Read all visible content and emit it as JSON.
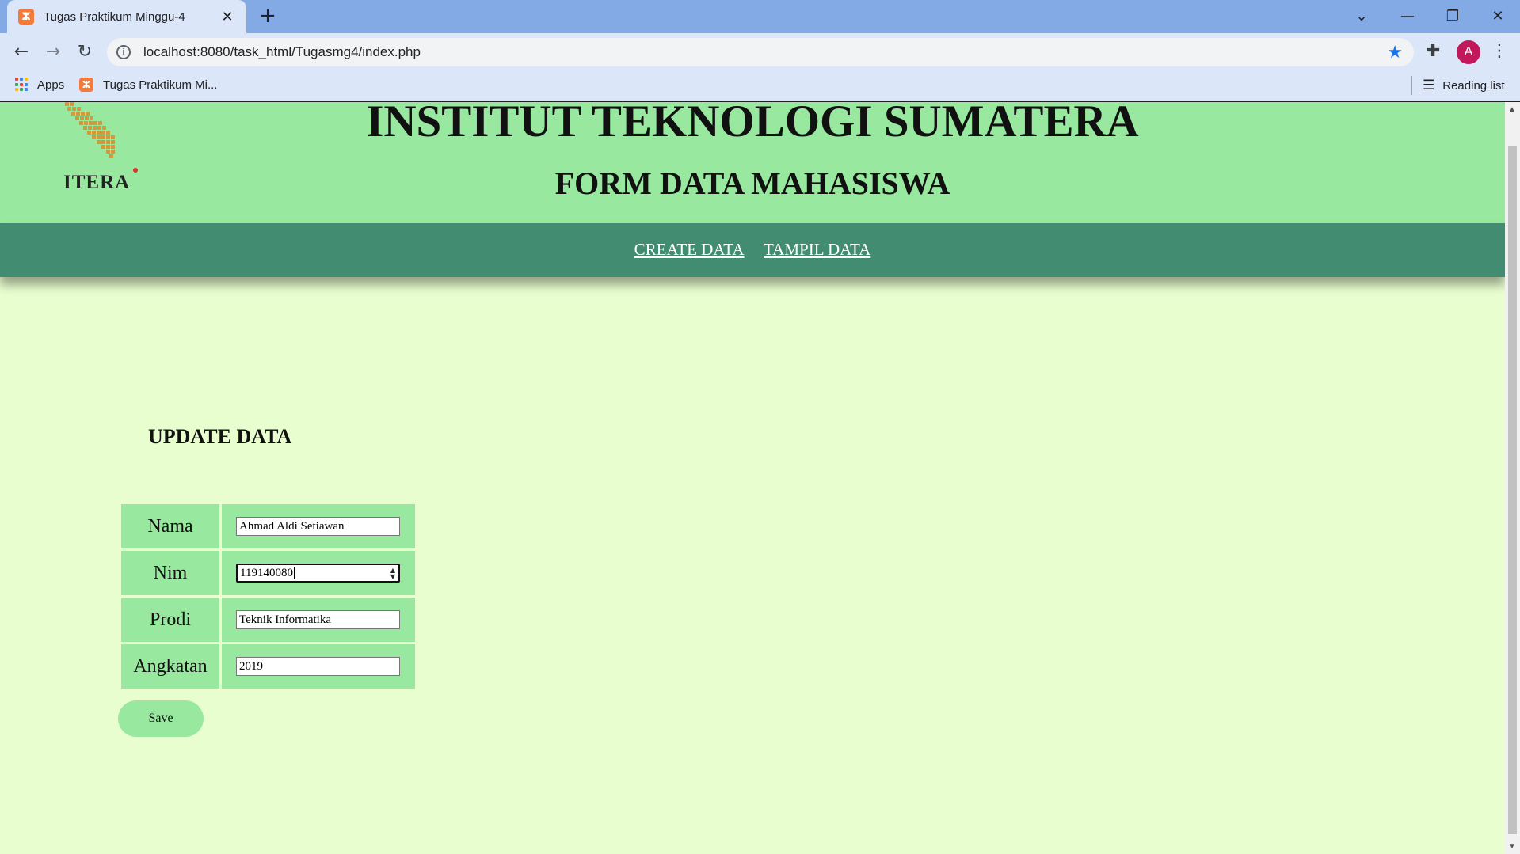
{
  "browser": {
    "tab_title": "Tugas Praktikum Minggu-4",
    "tab_favicon": "xampp-icon",
    "tab_close": "✕",
    "new_tab": "+",
    "window_controls": {
      "dropdown": "⌄",
      "minimize": "—",
      "restore": "❐",
      "close": "✕"
    },
    "nav": {
      "back": "←",
      "forward": "→",
      "reload": "↻"
    },
    "url": "localhost:8080/task_html/Tugasmg4/index.php",
    "avatar_letter": "A",
    "accent_color": "#1a73e8",
    "avatar_color": "#c2185b",
    "bookmarks": {
      "apps_label": "Apps",
      "item_label": "Tugas Praktikum Mi...",
      "reading_list_label": "Reading list"
    }
  },
  "page": {
    "logo_text": "ITERA",
    "title": "INSTITUT TEKNOLOGI SUMATERA",
    "subtitle": "FORM DATA MAHASISWA",
    "header_color": "#98e99f",
    "navbar_color": "#428c72",
    "background_color": "#e8fecf",
    "nav_links": {
      "create": "CREATE DATA",
      "tampil": "TAMPIL DATA"
    },
    "form": {
      "heading": "UPDATE DATA",
      "fields": {
        "nama": {
          "label": "Nama",
          "value": "Ahmad Aldi Setiawan"
        },
        "nim": {
          "label": "Nim",
          "value": "119140080"
        },
        "prodi": {
          "label": "Prodi",
          "value": "Teknik Informatika"
        },
        "angkatan": {
          "label": "Angkatan",
          "value": "2019"
        }
      },
      "save_label": "Save"
    }
  }
}
